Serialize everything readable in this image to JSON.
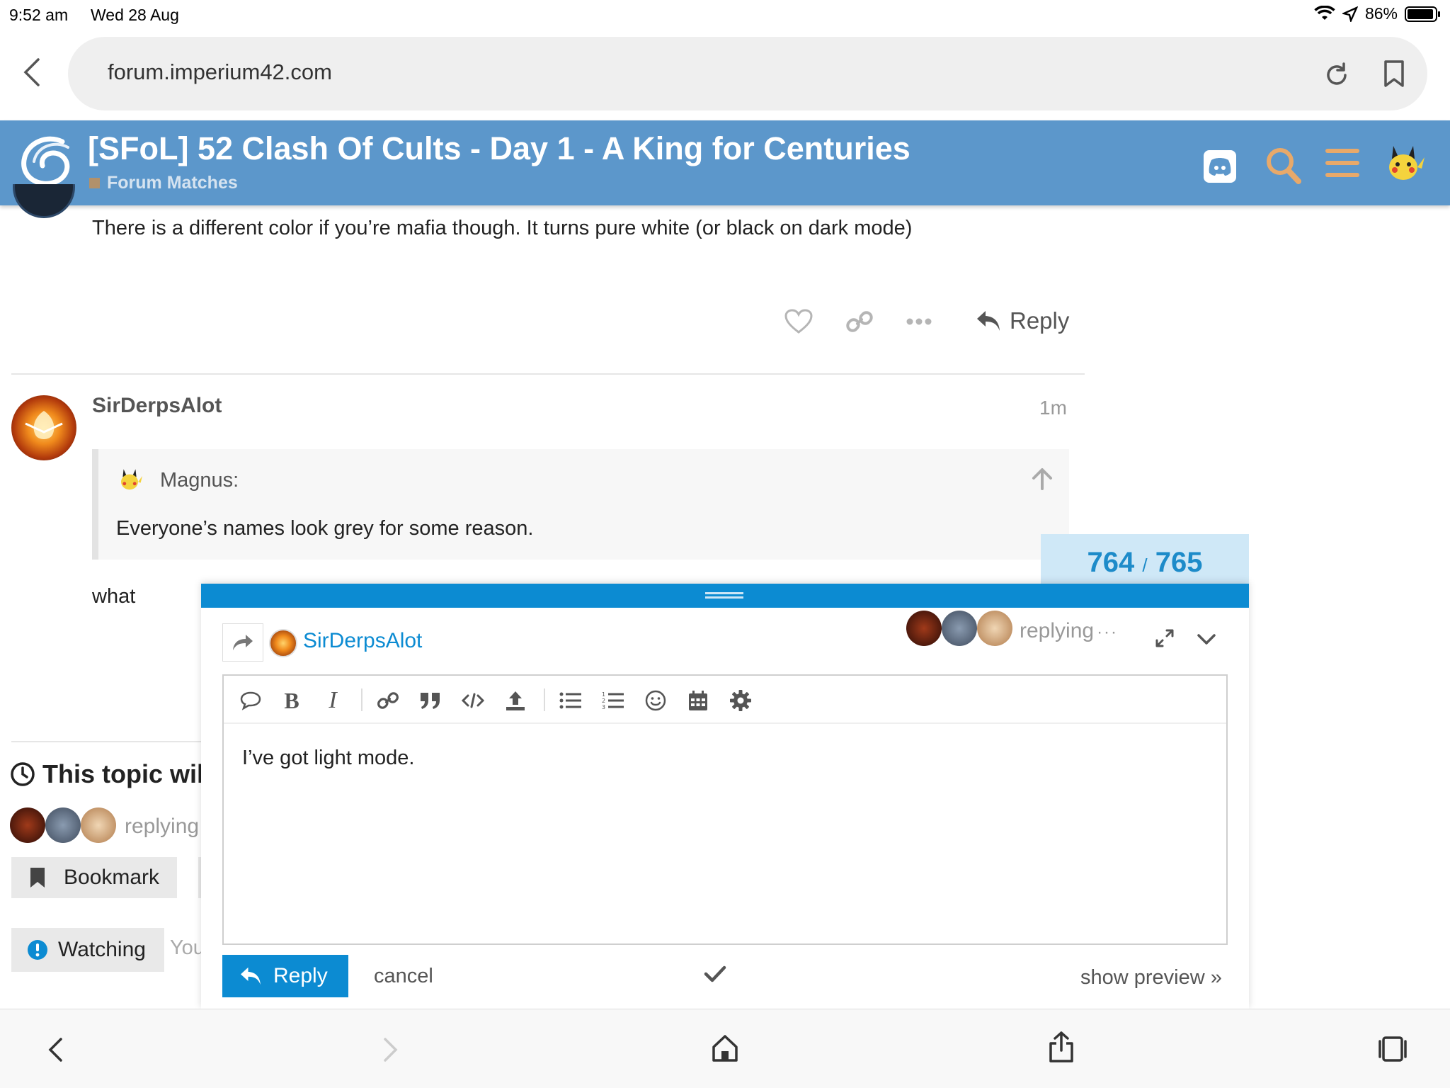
{
  "status": {
    "time": "9:52 am",
    "date": "Wed 28 Aug",
    "battery": "86%"
  },
  "browser": {
    "url": "forum.imperium42.com"
  },
  "header": {
    "title": "[SFoL] 52 Clash Of Cults - Day 1 - A King for Centuries",
    "category": "Forum Matches"
  },
  "post1": {
    "text": "There is a different color if you’re mafia though. It turns pure white (or black on dark mode)",
    "reply_label": "Reply"
  },
  "post2": {
    "author": "SirDerpsAlot",
    "time": "1m",
    "quote_author": "Magnus:",
    "quote_text": "Everyone’s names look grey for some reason.",
    "text": "what"
  },
  "progress": {
    "current": "764",
    "sep": "/",
    "total": "765"
  },
  "topic_footer": {
    "timer_text": "This topic wil",
    "replying": "replying",
    "bookmark_label": "Bookmark",
    "watching_label": "Watching",
    "watching_note": "You"
  },
  "composer": {
    "reply_to": "SirDerpsAlot",
    "replying_status": "replying",
    "body": "I’ve got light mode.",
    "submit_label": "Reply",
    "cancel_label": "cancel",
    "preview_label": "show preview »"
  },
  "colors": {
    "header": "#5c97cb",
    "accent": "#0c8bd2",
    "progress_bg": "#cfe8f7"
  }
}
